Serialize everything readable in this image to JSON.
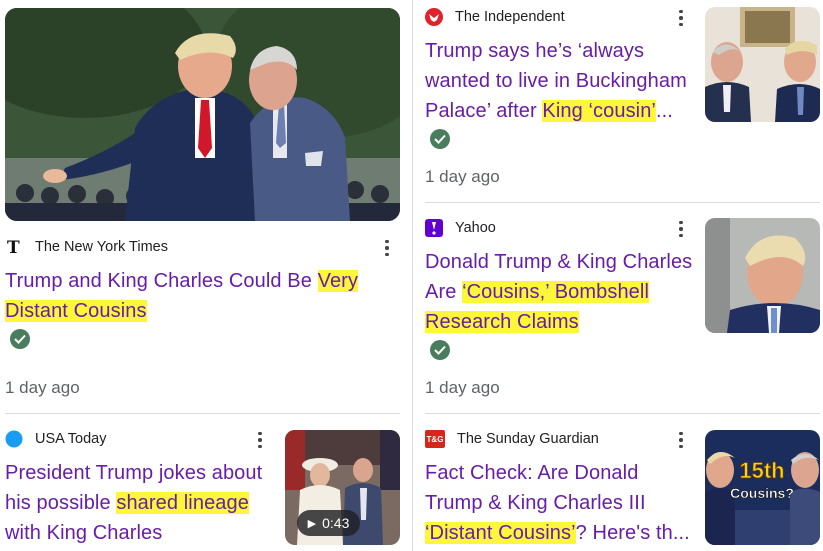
{
  "articles": [
    {
      "source": "The New York Times",
      "headline_plain": "Trump and King Charles Could Be ",
      "headline_hl": "Very Distant Cousins",
      "verified": true,
      "time": "1 day ago",
      "icon": "nyt-logo-icon",
      "image": "trump-and-king-charles-walking-photo"
    },
    {
      "source": "The Independent",
      "headline_line1": "Trump says he’s ‘always",
      "headline_line2": "wanted to live in Buckingham",
      "headline_line3_plain": "Palace’ after ",
      "headline_line3_hl": "King ‘cousin’",
      "headline_line3_end": "...",
      "verified": true,
      "time": "1 day ago",
      "icon": "independent-eagle-icon",
      "image": "king-charles-and-trump-meeting-photo"
    },
    {
      "source": "Yahoo",
      "headline_line1": "Donald Trump & King Charles",
      "headline_line2_plain": "Are ",
      "headline_line2_hl": "‘Cousins,’ Bombshell",
      "headline_line3_hl": "Research Claims",
      "verified": true,
      "time": "1 day ago",
      "icon": "yahoo-logo-icon",
      "image": "trump-portrait-photo"
    },
    {
      "source": "USA Today",
      "headline_line1": "President Trump jokes about",
      "headline_line2_plain": "his possible ",
      "headline_line2_hl": "shared lineage",
      "headline_line3": "with King Charles",
      "video_duration": "0:43",
      "icon": "usa-today-dot-icon",
      "image": "royal-procession-video-thumbnail"
    },
    {
      "source": "The Sunday Guardian",
      "icon_text": "T&G",
      "headline_line1": "Fact Check: Are Donald",
      "headline_line2": "Trump & King Charles III",
      "headline_line3_hl": "‘Distant Cousins’",
      "headline_line3_end": "? Here's th...",
      "icon": "sunday-guardian-logo-icon",
      "image": "15th-cousins-graphic-thumbnail",
      "thumb_text_1": "15th",
      "thumb_text_2": "Cousins?"
    }
  ],
  "colors": {
    "headline": "#681da8",
    "highlight": "#fdf73b",
    "verified": "#4a7d5e",
    "meta": "#5f6368"
  }
}
